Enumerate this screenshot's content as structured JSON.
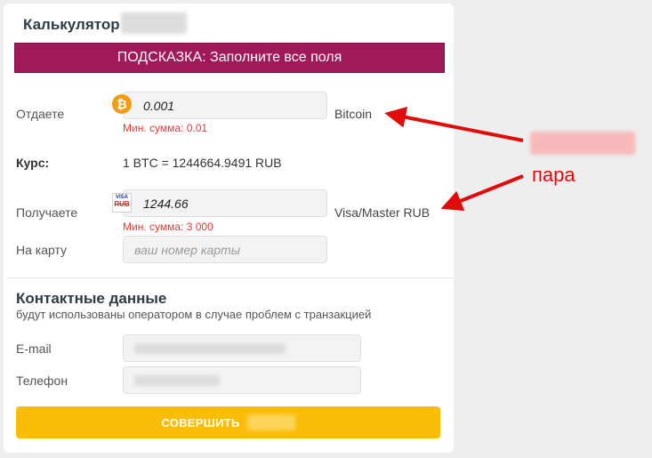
{
  "calculator": {
    "title": "Калькулятор",
    "hint": "ПОДСКАЗКА: Заполните все поля",
    "give": {
      "label": "Отдаете",
      "amount": "0.001",
      "currency": "Bitcoin",
      "min_sum": "Мин. сумма: 0.01",
      "icon": "bitcoin-icon"
    },
    "rate": {
      "label": "Курс:",
      "value": "1 BTC = 1244664.9491 RUB"
    },
    "receive": {
      "label": "Получаете",
      "amount": "1244.66",
      "currency": "Visa/Master RUB",
      "min_sum": "Мин. сумма: 3 000",
      "icon": "visa-rub-card-icon",
      "icon_text_top": "VISA",
      "icon_text_bottom": "RUB"
    },
    "card": {
      "label": "На карту",
      "placeholder": "ваш номер карты"
    }
  },
  "contacts": {
    "title": "Контактные данные",
    "subtitle": "будут использованы оператором в случае проблем с транзакцией",
    "email_label": "E-mail",
    "phone_label": "Телефон"
  },
  "submit": {
    "label": "СОВЕРШИТЬ"
  },
  "annotation": {
    "pair_text": "пара",
    "color": "#e10b0b"
  },
  "colors": {
    "hint_bg": "#a0195a",
    "submit_bg": "#f9bd08",
    "error": "#e53935"
  }
}
